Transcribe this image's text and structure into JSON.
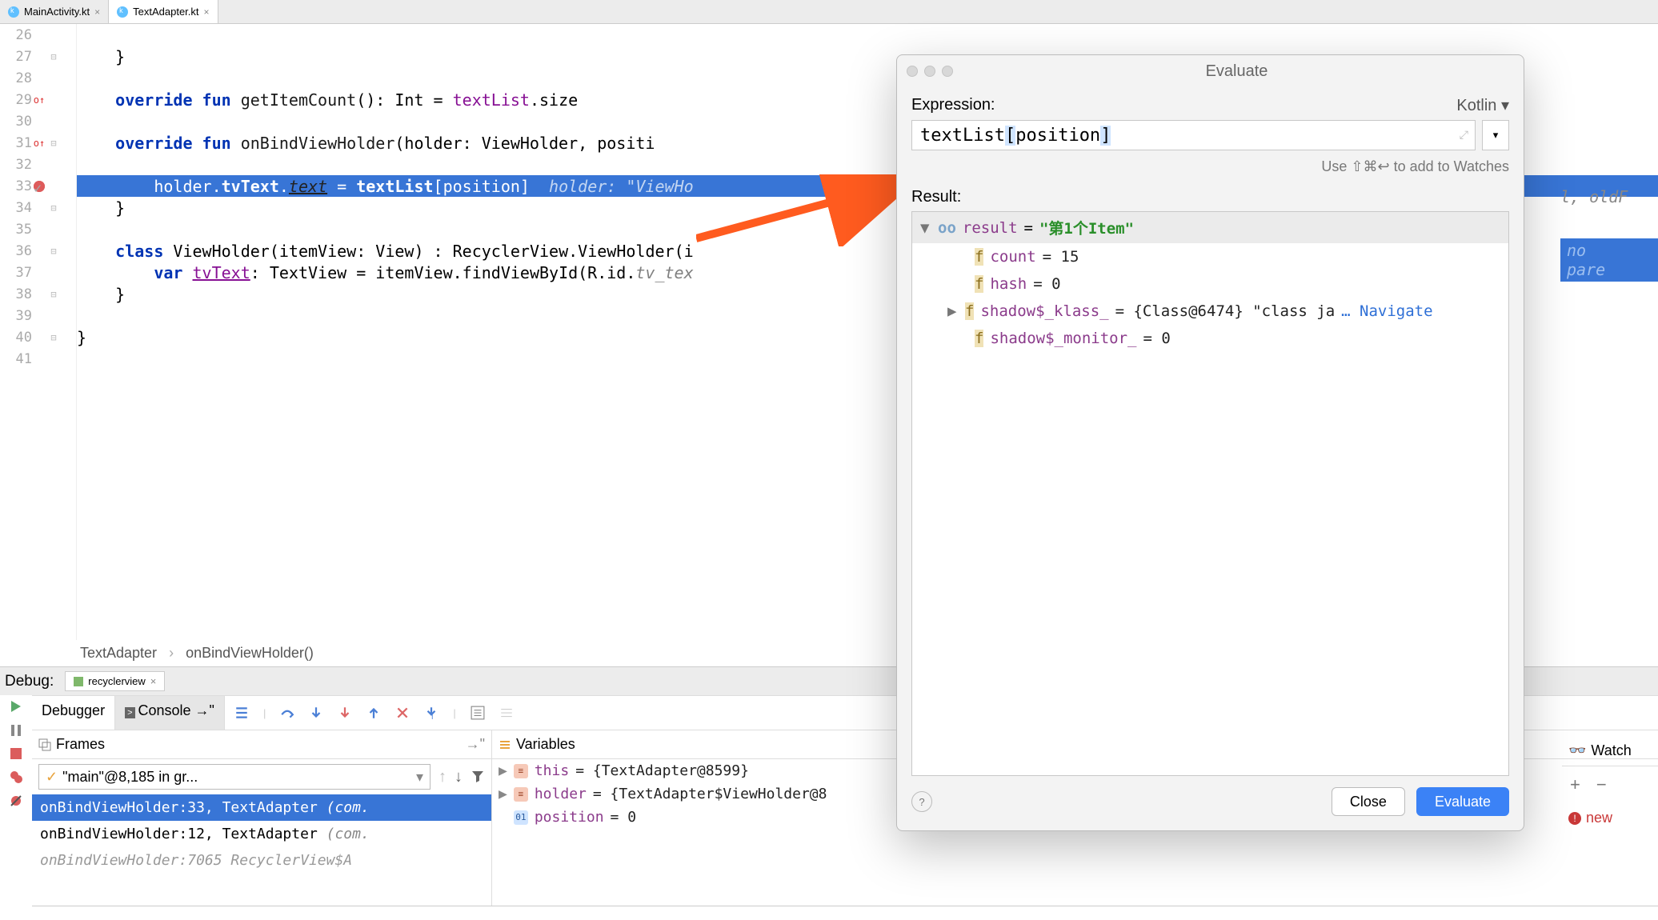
{
  "tabs": [
    {
      "label": "MainActivity.kt",
      "active": false
    },
    {
      "label": "TextAdapter.kt",
      "active": true
    }
  ],
  "gutter": {
    "lines": [
      26,
      27,
      28,
      29,
      30,
      31,
      32,
      33,
      34,
      35,
      36,
      37,
      38,
      39,
      40,
      41
    ],
    "override_lines": [
      29,
      31
    ],
    "breakpoint_line": 33
  },
  "code": {
    "l26": "",
    "l27": "    }",
    "l28": "",
    "l29a": "    override fun ",
    "l29b": "getItemCount",
    "l29c": "(): Int = ",
    "l29d": "textList",
    "l29e": ".size",
    "l30": "",
    "l31a": "    override fun ",
    "l31b": "onBindViewHolder",
    "l31c": "(holder: ViewHolder, positi",
    "l32": "",
    "l33a": "        holder.",
    "l33b": "tvText",
    "l33c": ".",
    "l33d": "text",
    "l33e": " = ",
    "l33f": "textList",
    "l33g": "[position]",
    "l33h": "  holder: \"ViewHo",
    "l34": "    }",
    "l35": "",
    "l36a": "    class ",
    "l36b": "ViewHolder",
    "l36c": "(itemView: View) : RecyclerView.ViewHolder(i",
    "l37a": "        var ",
    "l37b": "tvText",
    "l37c": ": TextView = itemView.findViewById(R.id.",
    "l37d": "tv_tex",
    "l38": "    }",
    "l39": "",
    "l40": "}",
    "l41": ""
  },
  "right_hint_1": "l, oldF",
  "right_hint_2": "no pare",
  "breadcrumbs": {
    "a": "TextAdapter",
    "b": "onBindViewHolder()"
  },
  "debug": {
    "label": "Debug:",
    "run_config": "recyclerview",
    "tabs": {
      "debugger": "Debugger",
      "console": "Console"
    }
  },
  "frames": {
    "title": "Frames",
    "thread": "\"main\"@8,185 in gr...",
    "rows": [
      {
        "txt": "onBindViewHolder:33, TextAdapter ",
        "pkg": "(com."
      },
      {
        "txt": "onBindViewHolder:12, TextAdapter ",
        "pkg": "(com."
      },
      {
        "txt": "onBindViewHolder:7065  RecyclerView$A",
        "pkg": ""
      }
    ]
  },
  "variables": {
    "title": "Variables",
    "rows": [
      {
        "badge": "red",
        "name": "this",
        "val": " = {TextAdapter@8599}"
      },
      {
        "badge": "red",
        "name": "holder",
        "val": " = {TextAdapter$ViewHolder@8"
      },
      {
        "badge": "blu",
        "name": "position",
        "val": " = 0"
      }
    ]
  },
  "watches_label": "Watch",
  "new_btn": "new",
  "evaluate": {
    "title": "Evaluate",
    "expr_label": "Expression:",
    "lang": "Kotlin",
    "expr_a": "textList",
    "expr_b": "[",
    "expr_c": "position",
    "expr_d": "]",
    "hint": "Use ⇧⌘↩ to add to Watches",
    "result_label": "Result:",
    "result": {
      "name": "result",
      "value": "\"第1个Item\"",
      "fields": [
        {
          "name": "count",
          "val": " = 15"
        },
        {
          "name": "hash",
          "val": " = 0"
        },
        {
          "name": "shadow$_klass_",
          "val": " = {Class@6474} \"class ja",
          "link": "… Navigate",
          "expand": true
        },
        {
          "name": "shadow$_monitor_",
          "val": " = 0"
        }
      ]
    },
    "close": "Close",
    "eval": "Evaluate"
  }
}
